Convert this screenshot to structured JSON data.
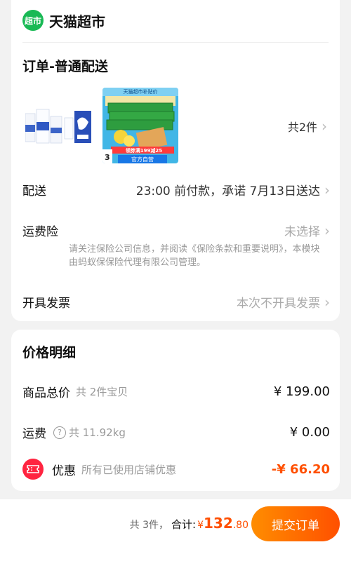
{
  "store": {
    "logo_text": "超市",
    "name": "天猫超市"
  },
  "order": {
    "title": "订单-普通配送",
    "product_count": "共2件",
    "products": [
      {
        "name": "milk-product-image"
      },
      {
        "banner": "天猫超市补贴价",
        "promo": "领券满199减25",
        "badge": "官方自营",
        "pack_number": "3"
      }
    ]
  },
  "delivery": {
    "label": "配送",
    "value": "23:00 前付款，承诺 7月13日送达"
  },
  "shipping_insurance": {
    "label": "运费险",
    "value": "未选择",
    "note": "请关注保险公司信息，并阅读《保险条款和重要说明》，本模块由蚂蚁保保险代理有限公司管理。"
  },
  "invoice": {
    "label": "开具发票",
    "value": "本次不开具发票"
  },
  "price_detail": {
    "title": "价格明细",
    "goods_total": {
      "label": "商品总价",
      "sub": "共 2件宝贝",
      "amount": "¥ 199.00"
    },
    "shipping": {
      "label": "运费",
      "help_icon": "?",
      "sub": "共 11.92kg",
      "amount": "¥ 0.00"
    },
    "discount": {
      "label": "优惠",
      "sub": "所有已使用店铺优惠",
      "amount": "-¥ 66.20"
    }
  },
  "bottom": {
    "count": "共 3件，",
    "total_label": "合计:",
    "currency": "¥",
    "total_int": "132",
    "total_dec": ".80",
    "submit_label": "提交订单"
  },
  "colors": {
    "accent": "#ff5000",
    "brand_green": "#19b955"
  }
}
